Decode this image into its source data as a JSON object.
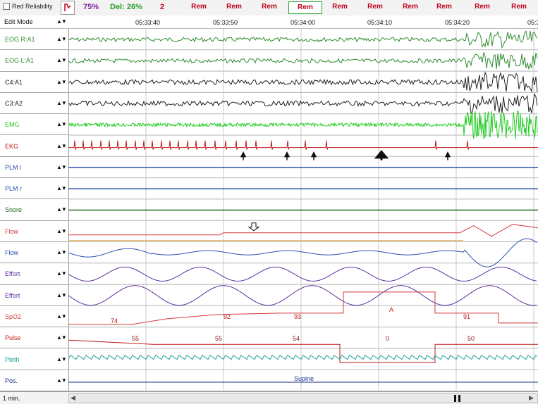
{
  "toolbar": {
    "reliability_label": "Red Reliability",
    "percent": "75%",
    "del_label": "Del: 26%",
    "count": "2",
    "stages": [
      "Rem",
      "Rem",
      "Rem",
      "Rem",
      "Rem",
      "Rem",
      "Rem",
      "Rem",
      "Rem",
      "Rem"
    ],
    "selected_stage_index": 3
  },
  "mode": {
    "label": "Edit Mode",
    "times": [
      "05:33:40",
      "05:33:50",
      "05:34:00",
      "05:34:10",
      "05:34:20",
      "05:3"
    ]
  },
  "channels": [
    {
      "name": "EOG R:A1",
      "color": "#2e8b2e"
    },
    {
      "name": "EOG L:A1",
      "color": "#2e8b2e"
    },
    {
      "name": "C4:A1",
      "color": "#222222"
    },
    {
      "name": "C3:A2",
      "color": "#222222"
    },
    {
      "name": "EMG",
      "color": "#22cc22"
    },
    {
      "name": "EKG",
      "color": "#c01818"
    },
    {
      "name": "PLM l",
      "color": "#2b4fb0"
    },
    {
      "name": "PLM r",
      "color": "#2b4fb0"
    },
    {
      "name": "Snore",
      "color": "#1f6b1f"
    },
    {
      "name": "Flow",
      "color": "#d43a3a"
    },
    {
      "name": "Flow",
      "color": "#2b4fb0"
    },
    {
      "name": "Effort",
      "color": "#5a2fa0"
    },
    {
      "name": "Effort",
      "color": "#5a2fa0"
    },
    {
      "name": "SpO2",
      "color": "#d43a3a"
    },
    {
      "name": "Pulse",
      "color": "#c01818"
    },
    {
      "name": "Pleth",
      "color": "#1fa39a"
    },
    {
      "name": "Pos.",
      "color": "#1a2f8a"
    }
  ],
  "annotations": {
    "spo2_values": [
      "74",
      "92",
      "93",
      "A",
      "91"
    ],
    "pulse_values": [
      "55",
      "55",
      "54",
      "0",
      "50"
    ],
    "pos_value": "Supine"
  },
  "footer": {
    "scale_label": "1 min."
  }
}
